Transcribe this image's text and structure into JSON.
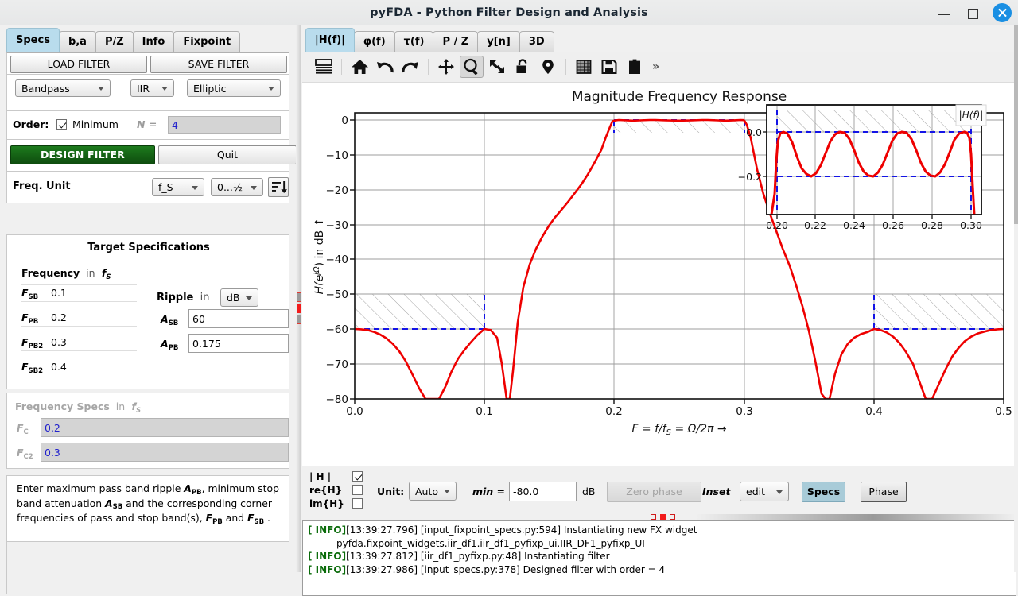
{
  "window": {
    "title": "pyFDA - Python Filter Design and Analysis",
    "minimize_label": "minimize",
    "maximize_label": "maximize",
    "close_label": "close"
  },
  "left_panel": {
    "tabs": [
      {
        "label": "Specs",
        "selected": true
      },
      {
        "label": "b,a",
        "selected": false
      },
      {
        "label": "P/Z",
        "selected": false
      },
      {
        "label": "Info",
        "selected": false
      },
      {
        "label": "Fixpoint",
        "selected": false
      }
    ],
    "load_filter": "LOAD FILTER",
    "save_filter": "SAVE FILTER",
    "response_type": "Bandpass",
    "filter_class": "IIR",
    "design_method": "Elliptic",
    "order_label": "Order:",
    "order_minimum_label": "Minimum",
    "order_minimum_checked": true,
    "order_n_label": "N =",
    "order_n_value": "4",
    "design_filter": "DESIGN FILTER",
    "quit": "Quit",
    "freq_unit_label": "Freq. Unit",
    "freq_unit_value": "f_S",
    "freq_range_value": "0...½",
    "sort_icon": "sort-descending-icon",
    "target_specs": {
      "title": "Target Specifications",
      "frequency_heading": "Frequency",
      "frequency_unit_suffix": "in",
      "frequency_unit": "fS",
      "rows": [
        {
          "label": "F",
          "sub": "SB",
          "value": "0.1"
        },
        {
          "label": "F",
          "sub": "PB",
          "value": "0.2"
        },
        {
          "label": "F",
          "sub": "PB2",
          "value": "0.3"
        },
        {
          "label": "F",
          "sub": "SB2",
          "value": "0.4"
        }
      ],
      "ripple_heading": "Ripple",
      "ripple_unit_suffix": "in",
      "ripple_unit": "dB",
      "amp_rows": [
        {
          "label": "A",
          "sub": "SB",
          "value": "60"
        },
        {
          "label": "A",
          "sub": "PB",
          "value": "0.175"
        }
      ]
    },
    "freq_specs": {
      "heading": "Frequency Specs",
      "unit_suffix": "in",
      "unit": "fS",
      "rows": [
        {
          "label": "F",
          "sub": "C",
          "value": "0.2"
        },
        {
          "label": "F",
          "sub": "C2",
          "value": "0.3"
        }
      ]
    },
    "help_text_parts": [
      "Enter maximum pass band ripple ",
      "APB",
      ", minimum stop band attenuation ",
      "ASB",
      " and the corresponding corner frequencies of pass and stop band(s), ",
      "FPB",
      " and ",
      "FSB",
      " ."
    ],
    "help_text": "Enter maximum pass band ripple APB, minimum stop band attenuation ASB and the corresponding corner frequencies of pass and stop band(s), FPB and FSB ."
  },
  "right_panel": {
    "tabs": [
      {
        "label": "|H(f)|",
        "selected": true
      },
      {
        "label": "φ(f)",
        "selected": false
      },
      {
        "label": "τ(f)",
        "selected": false
      },
      {
        "label": "P / Z",
        "selected": false
      },
      {
        "label": "y[n]",
        "selected": false
      },
      {
        "label": "3D",
        "selected": false
      }
    ],
    "toolbar": [
      {
        "name": "menu-lines-icon",
        "tooltip": "Toggle toolbar"
      },
      {
        "name": "home-icon",
        "tooltip": "Home"
      },
      {
        "name": "undo-arrow-icon",
        "tooltip": "Back"
      },
      {
        "name": "redo-arrow-icon",
        "tooltip": "Forward"
      },
      {
        "name": "move-pan-icon",
        "tooltip": "Pan"
      },
      {
        "name": "zoom-magnifier-icon",
        "tooltip": "Zoom",
        "active": true
      },
      {
        "name": "zoom-fit-arrows-icon",
        "tooltip": "Full view"
      },
      {
        "name": "lock-open-icon",
        "tooltip": "Lock axes"
      },
      {
        "name": "location-pin-icon",
        "tooltip": "Marker"
      },
      {
        "name": "grid-icon",
        "tooltip": "Grid"
      },
      {
        "name": "save-disk-icon",
        "tooltip": "Save figure"
      },
      {
        "name": "clipboard-icon",
        "tooltip": "Copy to clipboard"
      },
      {
        "name": "overflow-chevrons-icon",
        "tooltip": "More"
      }
    ],
    "overflow_label": "»",
    "controls": {
      "mag_label": "| H |",
      "mag_checked": true,
      "re_label": "re{H}",
      "re_checked": false,
      "im_label": "im{H}",
      "im_checked": false,
      "unit_label": "Unit:",
      "unit_value": "Auto",
      "min_label": "min =",
      "min_value": "-80.0",
      "min_unit": "dB",
      "zero_phase_label": "Zero phase",
      "zero_phase_enabled": false,
      "inset_label": "Inset",
      "inset_value": "edit",
      "specs_label": "Specs",
      "specs_active": true,
      "phase_label": "Phase"
    }
  },
  "log": {
    "lines": [
      {
        "level": "[ INFO]",
        "text": "[13:39:27.796] [input_fixpoint_specs.py:594] Instantiating new FX widget",
        "cont": "pyfda.fixpoint_widgets.iir_df1.iir_df1_pyfixp_ui.IIR_DF1_pyfixp_UI"
      },
      {
        "level": "[ INFO]",
        "text": "[13:39:27.812] [iir_df1_pyfixp.py:48] Instantiating filter",
        "cont": ""
      },
      {
        "level": "[ INFO]",
        "text": "[13:39:27.986] [input_specs.py:378] Designed filter with order = 4",
        "cont": ""
      }
    ]
  },
  "colors": {
    "accent_tab": "#b9dced",
    "design_button": "#146314",
    "curve": "#ee0000",
    "spec_line": "#1414e6",
    "hatch": "#8c8c8c",
    "log_level": "#0a6b0a",
    "close_button": "#1a8fe3"
  },
  "chart_data": {
    "type": "line",
    "title": "Magnitude Frequency Response",
    "xlabel": "F = f/fS = Ω/2π →",
    "ylabel": "H(ejΩ) in dB →",
    "xlim": [
      0.0,
      0.5
    ],
    "ylim": [
      -80,
      2
    ],
    "xticks": [
      "0.0",
      "0.1",
      "0.2",
      "0.3",
      "0.4",
      "0.5"
    ],
    "xtick_values": [
      0.0,
      0.1,
      0.2,
      0.3,
      0.4,
      0.5
    ],
    "yticks": [
      "0",
      "−10",
      "−20",
      "−30",
      "−40",
      "−50",
      "−60",
      "−70",
      "−80"
    ],
    "ytick_values": [
      0,
      -10,
      -20,
      -30,
      -40,
      -50,
      -60,
      -70,
      -80
    ],
    "grid": true,
    "legend": null,
    "series": [
      {
        "name": "|H(f)| magnitude",
        "color": "#ee0000",
        "points": [
          [
            0.0,
            -60.0
          ],
          [
            0.005,
            -60.1
          ],
          [
            0.01,
            -60.3
          ],
          [
            0.015,
            -60.8
          ],
          [
            0.02,
            -61.6
          ],
          [
            0.025,
            -62.7
          ],
          [
            0.03,
            -64.3
          ],
          [
            0.035,
            -66.4
          ],
          [
            0.04,
            -69.2
          ],
          [
            0.045,
            -72.8
          ],
          [
            0.05,
            -77.0
          ],
          [
            0.055,
            -80.0
          ],
          [
            0.06,
            -80.0
          ],
          [
            0.065,
            -80.0
          ],
          [
            0.07,
            -76.5
          ],
          [
            0.075,
            -72.0
          ],
          [
            0.08,
            -68.5
          ],
          [
            0.085,
            -66.0
          ],
          [
            0.09,
            -63.8
          ],
          [
            0.095,
            -61.8
          ],
          [
            0.1,
            -60.0
          ],
          [
            0.105,
            -60.3
          ],
          [
            0.11,
            -62.5
          ],
          [
            0.114,
            -70.0
          ],
          [
            0.118,
            -80.0
          ],
          [
            0.12,
            -80.0
          ],
          [
            0.122,
            -72.0
          ],
          [
            0.126,
            -58.0
          ],
          [
            0.13,
            -48.0
          ],
          [
            0.135,
            -41.5
          ],
          [
            0.14,
            -37.0
          ],
          [
            0.145,
            -33.5
          ],
          [
            0.15,
            -30.5
          ],
          [
            0.155,
            -28.0
          ],
          [
            0.16,
            -25.6
          ],
          [
            0.165,
            -23.4
          ],
          [
            0.17,
            -21.0
          ],
          [
            0.175,
            -18.6
          ],
          [
            0.18,
            -15.8
          ],
          [
            0.185,
            -12.6
          ],
          [
            0.19,
            -8.8
          ],
          [
            0.194,
            -5.0
          ],
          [
            0.197,
            -2.2
          ],
          [
            0.199,
            -0.6
          ],
          [
            0.2,
            -0.175
          ],
          [
            0.204,
            0.0
          ],
          [
            0.21,
            -0.1
          ],
          [
            0.215,
            -0.175
          ],
          [
            0.22,
            -0.12
          ],
          [
            0.228,
            0.0
          ],
          [
            0.232,
            0.0
          ],
          [
            0.24,
            -0.1
          ],
          [
            0.25,
            -0.175
          ],
          [
            0.26,
            -0.1
          ],
          [
            0.268,
            0.0
          ],
          [
            0.272,
            0.0
          ],
          [
            0.28,
            -0.12
          ],
          [
            0.286,
            -0.175
          ],
          [
            0.292,
            -0.08
          ],
          [
            0.297,
            0.0
          ],
          [
            0.299,
            -0.05
          ],
          [
            0.3,
            -0.175
          ],
          [
            0.302,
            -1.2
          ],
          [
            0.305,
            -5.0
          ],
          [
            0.31,
            -14.0
          ],
          [
            0.315,
            -21.0
          ],
          [
            0.32,
            -26.5
          ],
          [
            0.325,
            -31.5
          ],
          [
            0.33,
            -36.5
          ],
          [
            0.335,
            -41.5
          ],
          [
            0.34,
            -47.0
          ],
          [
            0.345,
            -53.0
          ],
          [
            0.35,
            -60.0
          ],
          [
            0.355,
            -68.5
          ],
          [
            0.36,
            -78.0
          ],
          [
            0.363,
            -80.0
          ],
          [
            0.366,
            -80.0
          ],
          [
            0.37,
            -72.0
          ],
          [
            0.375,
            -66.5
          ],
          [
            0.38,
            -63.5
          ],
          [
            0.385,
            -61.8
          ],
          [
            0.39,
            -60.7
          ],
          [
            0.395,
            -60.15
          ],
          [
            0.4,
            -60.0
          ],
          [
            0.405,
            -60.3
          ],
          [
            0.41,
            -61.0
          ],
          [
            0.415,
            -62.2
          ],
          [
            0.42,
            -64.0
          ],
          [
            0.425,
            -66.5
          ],
          [
            0.43,
            -70.0
          ],
          [
            0.435,
            -75.0
          ],
          [
            0.44,
            -80.0
          ],
          [
            0.445,
            -80.0
          ],
          [
            0.45,
            -76.0
          ],
          [
            0.455,
            -71.5
          ],
          [
            0.46,
            -68.0
          ],
          [
            0.465,
            -65.5
          ],
          [
            0.47,
            -63.5
          ],
          [
            0.475,
            -62.2
          ],
          [
            0.48,
            -61.3
          ],
          [
            0.485,
            -60.7
          ],
          [
            0.49,
            -60.3
          ],
          [
            0.495,
            -60.1
          ],
          [
            0.5,
            -60.0
          ]
        ]
      }
    ],
    "spec_lines": {
      "color": "#1414e6",
      "stopband_level_db": -60,
      "passband_ripple_db": -0.175,
      "passband_top_db": 0,
      "f_sb": 0.1,
      "f_pb": 0.2,
      "f_pb2": 0.3,
      "f_sb2": 0.4
    },
    "hatched_regions": [
      {
        "name": "lower-stopband",
        "x0": 0.0,
        "x1": 0.1,
        "y0": -60,
        "y1": -50
      },
      {
        "name": "passband",
        "x0": 0.2,
        "x1": 0.3,
        "y0": -0.175,
        "y1": 0
      },
      {
        "name": "upper-stopband",
        "x0": 0.4,
        "x1": 0.5,
        "y0": -60,
        "y1": -50
      }
    ],
    "inset": {
      "title": "|H(f)|",
      "xlim": [
        0.195,
        0.302
      ],
      "ylim": [
        -0.3,
        0.06
      ],
      "xticks": [
        "0.20",
        "0.22",
        "0.24",
        "0.26",
        "0.28",
        "0.30"
      ],
      "xtick_values": [
        0.2,
        0.22,
        0.24,
        0.26,
        0.28,
        0.3
      ],
      "yticks": [
        "0.0",
        "−0.2"
      ],
      "ytick_values": [
        0.0,
        -0.2
      ],
      "ripple_min_db": -0.175,
      "ripple_max_db": 0.0
    }
  }
}
